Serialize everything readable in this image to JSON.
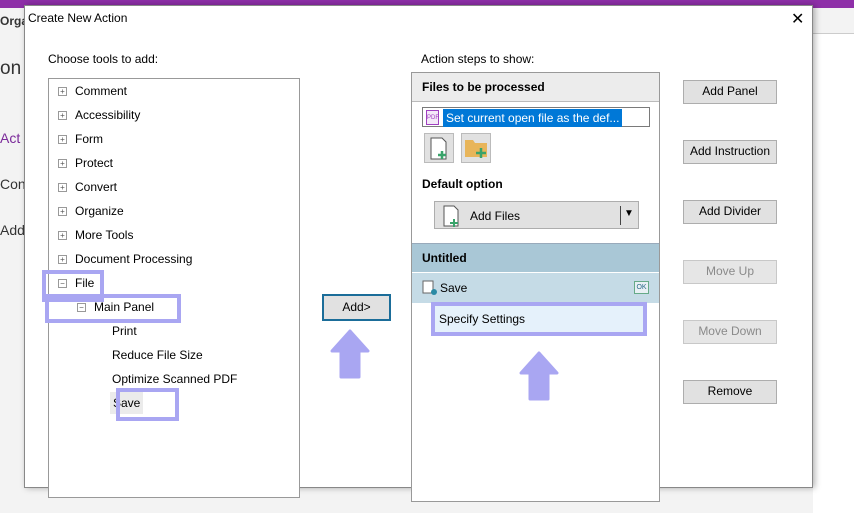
{
  "background": {
    "tab": "Orga",
    "heading": "on",
    "items": [
      "Act",
      "Con",
      "Add"
    ]
  },
  "dialog": {
    "title": "Create New Action",
    "close_icon": "close-icon",
    "left_label": "Choose tools to add:",
    "right_label": "Action steps to show:",
    "tree": [
      {
        "label": "Comment",
        "sign": "+"
      },
      {
        "label": "Accessibility",
        "sign": "+"
      },
      {
        "label": "Form",
        "sign": "+"
      },
      {
        "label": "Protect",
        "sign": "+"
      },
      {
        "label": "Convert",
        "sign": "+"
      },
      {
        "label": "Organize",
        "sign": "+"
      },
      {
        "label": "More Tools",
        "sign": "+"
      },
      {
        "label": "Document Processing",
        "sign": "+"
      },
      {
        "label": "File",
        "sign": "−"
      }
    ],
    "file_children": {
      "panel": "Main Panel",
      "panel_sign": "−",
      "items": [
        "Print",
        "Reduce File Size",
        "Optimize Scanned PDF",
        "Save"
      ]
    },
    "add_button": "Add>",
    "steps": {
      "files_header": "Files to be processed",
      "file_input": "Set current open file as the def...",
      "default_label": "Default option",
      "dropdown": "Add Files",
      "section": "Untitled",
      "step": "Save",
      "step_badge": "OK",
      "specify": "Specify Settings"
    },
    "side_buttons": [
      {
        "label": "Add Panel",
        "enabled": true
      },
      {
        "label": "Add Instruction",
        "enabled": true
      },
      {
        "label": "Add Divider",
        "enabled": true
      },
      {
        "label": "Move Up",
        "enabled": false
      },
      {
        "label": "Move Down",
        "enabled": false
      },
      {
        "label": "Remove",
        "enabled": true
      }
    ]
  },
  "colors": {
    "highlight": "#a9a6f2",
    "selection": "#0078d7",
    "section": "#a9c7d6",
    "step": "#c5dbe6",
    "titlebar": "#8e2fa8"
  }
}
